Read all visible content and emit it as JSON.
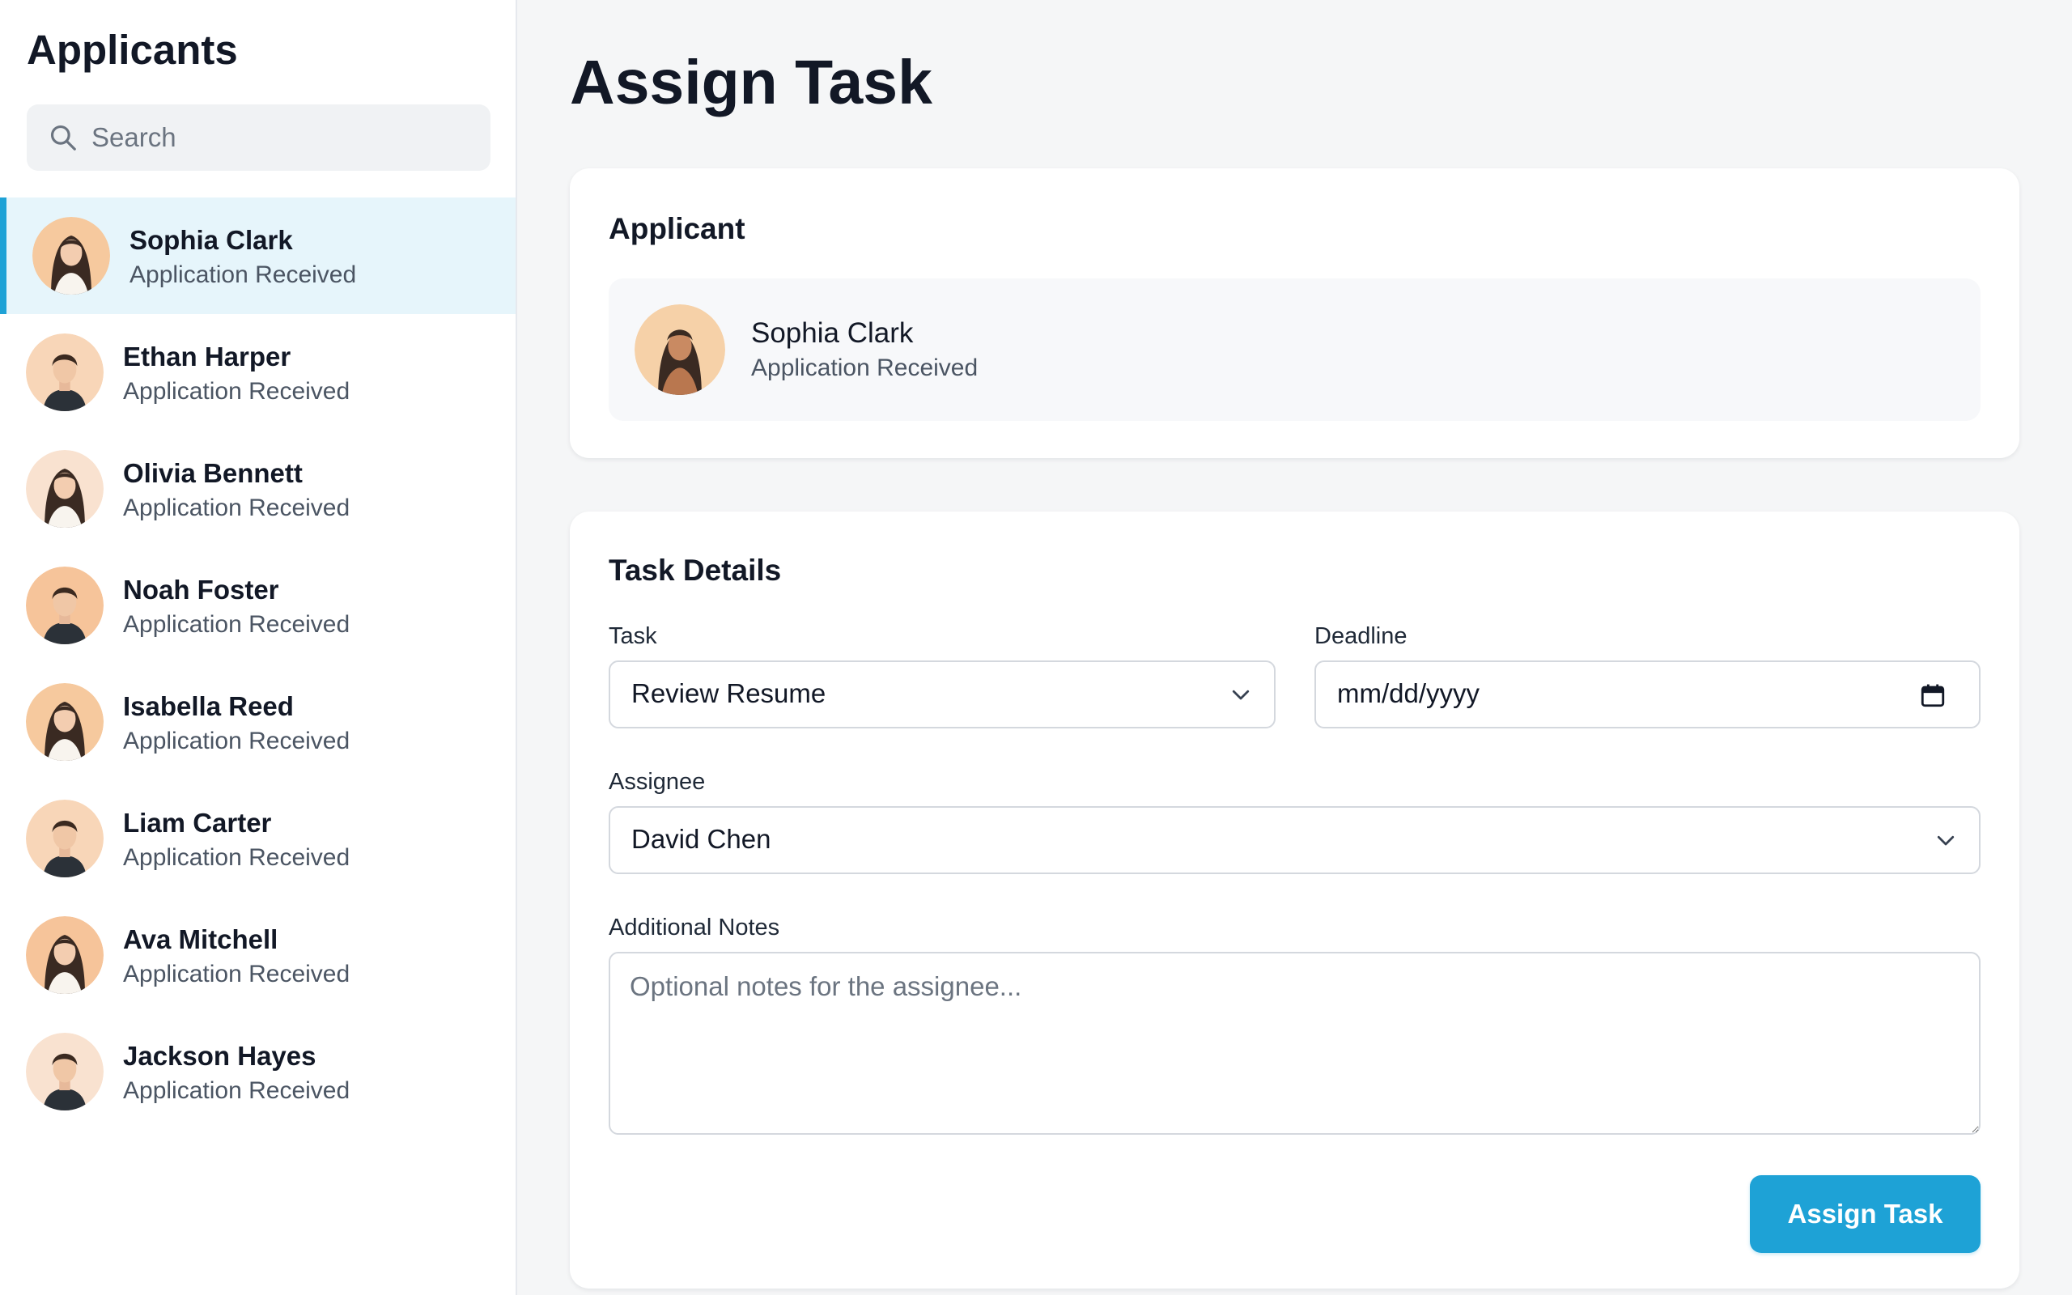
{
  "sidebar": {
    "title": "Applicants",
    "search": {
      "placeholder": "Search",
      "value": ""
    },
    "items": [
      {
        "name": "Sophia Clark",
        "status": "Application Received",
        "selected": true,
        "avatar": "female-long-hair"
      },
      {
        "name": "Ethan Harper",
        "status": "Application Received",
        "selected": false,
        "avatar": "male-short-hair"
      },
      {
        "name": "Olivia Bennett",
        "status": "Application Received",
        "selected": false,
        "avatar": "female-long-hair"
      },
      {
        "name": "Noah Foster",
        "status": "Application Received",
        "selected": false,
        "avatar": "male-short-hair"
      },
      {
        "name": "Isabella Reed",
        "status": "Application Received",
        "selected": false,
        "avatar": "female-long-hair"
      },
      {
        "name": "Liam Carter",
        "status": "Application Received",
        "selected": false,
        "avatar": "male-short-hair"
      },
      {
        "name": "Ava Mitchell",
        "status": "Application Received",
        "selected": false,
        "avatar": "female-long-hair"
      },
      {
        "name": "Jackson Hayes",
        "status": "Application Received",
        "selected": false,
        "avatar": "male-short-hair"
      }
    ]
  },
  "main": {
    "title": "Assign Task",
    "applicant_card": {
      "heading": "Applicant",
      "name": "Sophia Clark",
      "status": "Application Received"
    },
    "task_card": {
      "heading": "Task Details",
      "task": {
        "label": "Task",
        "value": "Review Resume"
      },
      "deadline": {
        "label": "Deadline",
        "value": "mm/dd/yyyy"
      },
      "assignee": {
        "label": "Assignee",
        "value": "David Chen"
      },
      "notes": {
        "label": "Additional Notes",
        "placeholder": "Optional notes for the assignee..."
      },
      "submit_label": "Assign Task"
    }
  },
  "colors": {
    "accent": "#1ea2d6",
    "selected_row_bg": "#e6f5fb",
    "page_bg": "#f5f6f7",
    "text_primary": "#121826",
    "text_secondary": "#4b5563"
  },
  "icons": [
    "search-icon",
    "chevron-down-icon",
    "calendar-icon",
    "resize-handle-icon"
  ]
}
